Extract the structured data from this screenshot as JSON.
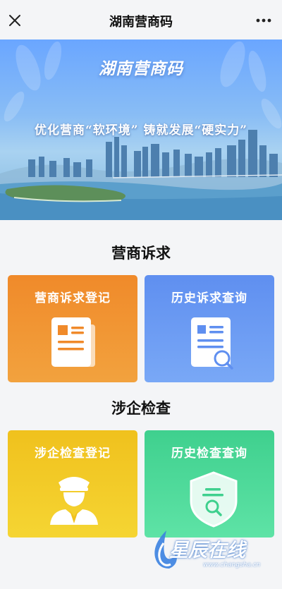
{
  "navbar": {
    "title": "湖南营商码",
    "close_icon": "close-icon",
    "more_icon": "more-dots-icon"
  },
  "banner": {
    "title": "湖南营商码",
    "slogan": "优化营商“软环境” 铸就发展“硬实力”"
  },
  "sections": [
    {
      "title": "营商诉求",
      "cards": [
        {
          "label": "营商诉求登记",
          "icon": "document-form-icon",
          "color": "#f08a2a"
        },
        {
          "label": "历史诉求查询",
          "icon": "document-search-icon",
          "color": "#5f8ff0"
        }
      ]
    },
    {
      "title": "涉企检查",
      "cards": [
        {
          "label": "涉企检查登记",
          "icon": "inspector-officer-icon",
          "color": "#f0c11d"
        },
        {
          "label": "历史检查查询",
          "icon": "shield-search-icon",
          "color": "#3fd08e"
        }
      ]
    }
  ],
  "watermark": {
    "text": "星辰在线",
    "url": "www.changsha.cn"
  }
}
